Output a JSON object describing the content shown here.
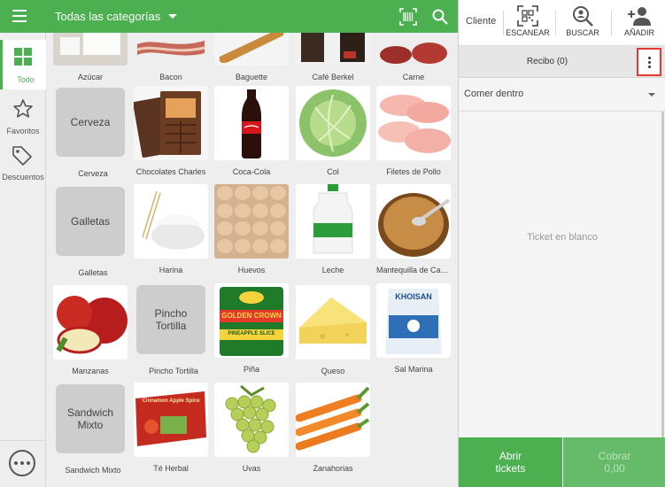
{
  "topbar": {
    "category": "Todas las categorías"
  },
  "sidebar": {
    "items": [
      {
        "label": "Todo",
        "icon": "grid-icon"
      },
      {
        "label": "Favoritos",
        "icon": "star-icon"
      },
      {
        "label": "Descuentos",
        "icon": "tag-icon"
      }
    ]
  },
  "products": [
    {
      "name": "Azúcar"
    },
    {
      "name": "Bacon"
    },
    {
      "name": "Baguette"
    },
    {
      "name": "Café Berkel"
    },
    {
      "name": "Carne"
    },
    {
      "name": "Cerveza",
      "text": "Cerveza"
    },
    {
      "name": "Chocolates Charles"
    },
    {
      "name": "Coca-Cola"
    },
    {
      "name": "Col"
    },
    {
      "name": "Filetes de Pollo"
    },
    {
      "name": "Galletas",
      "text": "Galletas"
    },
    {
      "name": "Harina"
    },
    {
      "name": "Huevos"
    },
    {
      "name": "Leche"
    },
    {
      "name": "Mantequilla de Caca..."
    },
    {
      "name": "Manzanas"
    },
    {
      "name": "Pincho Tortilla",
      "text": "Pincho Tortilla"
    },
    {
      "name": "Piña",
      "label_top": "GOLDEN CROWN",
      "label_bottom": "PINEAPPLE SLICE"
    },
    {
      "name": "Queso"
    },
    {
      "name": "Sal Marina",
      "brand": "KHOISAN"
    },
    {
      "name": "Sandwich Mixto",
      "text": "Sandwich Mixto"
    },
    {
      "name": "Té Herbal",
      "label_top": "Cinnamon Apple Spice"
    },
    {
      "name": "Uvas"
    },
    {
      "name": "Zanahorias"
    }
  ],
  "right": {
    "customer": "Cliente",
    "actions": [
      {
        "label": "ESCANEAR",
        "icon": "qr-scan-icon"
      },
      {
        "label": "BUSCAR",
        "icon": "search-person-icon"
      },
      {
        "label": "AÑADIR",
        "icon": "add-person-icon"
      }
    ],
    "receipt": "Recibo (0)",
    "dining_option": "Comer dentro",
    "empty_ticket": "Ticket en blanco",
    "open_tickets": "Abrir\ntickets",
    "charge_label": "Cobrar",
    "charge_amount": "0,00"
  },
  "colors": {
    "accent": "#4caf50",
    "highlight": "#e53935"
  }
}
